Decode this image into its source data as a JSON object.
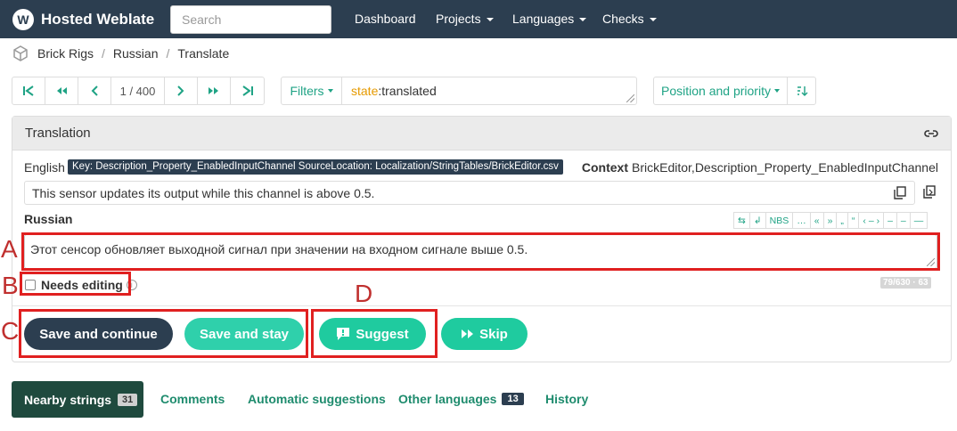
{
  "brand": {
    "logo_glyph": "W",
    "title": "Hosted Weblate"
  },
  "search": {
    "placeholder": "Search"
  },
  "nav": {
    "dashboard": "Dashboard",
    "projects": "Projects",
    "languages": "Languages",
    "checks": "Checks"
  },
  "breadcrumb": {
    "project": "Brick Rigs",
    "language": "Russian",
    "page": "Translate"
  },
  "pager": {
    "first": "|<",
    "prev_fast": "<<",
    "prev": "<",
    "position": "1 / 400",
    "next": ">",
    "next_fast": ">>",
    "last": ">|"
  },
  "filters": {
    "label": "Filters",
    "query_key": "state",
    "query_sep": ":",
    "query_value": "translated"
  },
  "sort": {
    "label": "Position and priority",
    "direction_icon": "sort-descending-icon"
  },
  "panel": {
    "title": "Translation",
    "source_language": "English",
    "key_badge": "Key: Description_Property_EnabledInputChannel SourceLocation: Localization/StringTables/BrickEditor.csv",
    "context_label": "Context",
    "context_value": "BrickEditor,Description_Property_EnabledInputChannel",
    "source_text": "This sensor updates its output while this channel is above 0.5.",
    "target_language": "Russian",
    "target_text": "Этот сенсор обновляет выходной сигнал при значении на входном сигнале выше 0.5.",
    "needs_editing_label": "Needs editing",
    "counter": "79/630 · 63"
  },
  "charbar": [
    "⇆",
    "↲",
    "NBS",
    "…",
    "«",
    "»",
    "„",
    "“",
    "‹ – ›",
    "–",
    "–",
    "—"
  ],
  "buttons": {
    "save_continue": "Save and continue",
    "save_stay": "Save and stay",
    "suggest": "Suggest",
    "skip": "Skip"
  },
  "annotations": {
    "a": "A",
    "b": "B",
    "c": "C",
    "d": "D"
  },
  "tabs": {
    "nearby": "Nearby strings",
    "nearby_count": "31",
    "comments": "Comments",
    "automatic": "Automatic suggestions",
    "other": "Other languages",
    "other_count": "13",
    "history": "History"
  },
  "colors": {
    "navbar": "#2c3e50",
    "accent": "#1fa385",
    "button_green": "#2fd0ab",
    "annotation_red": "#e02020"
  }
}
